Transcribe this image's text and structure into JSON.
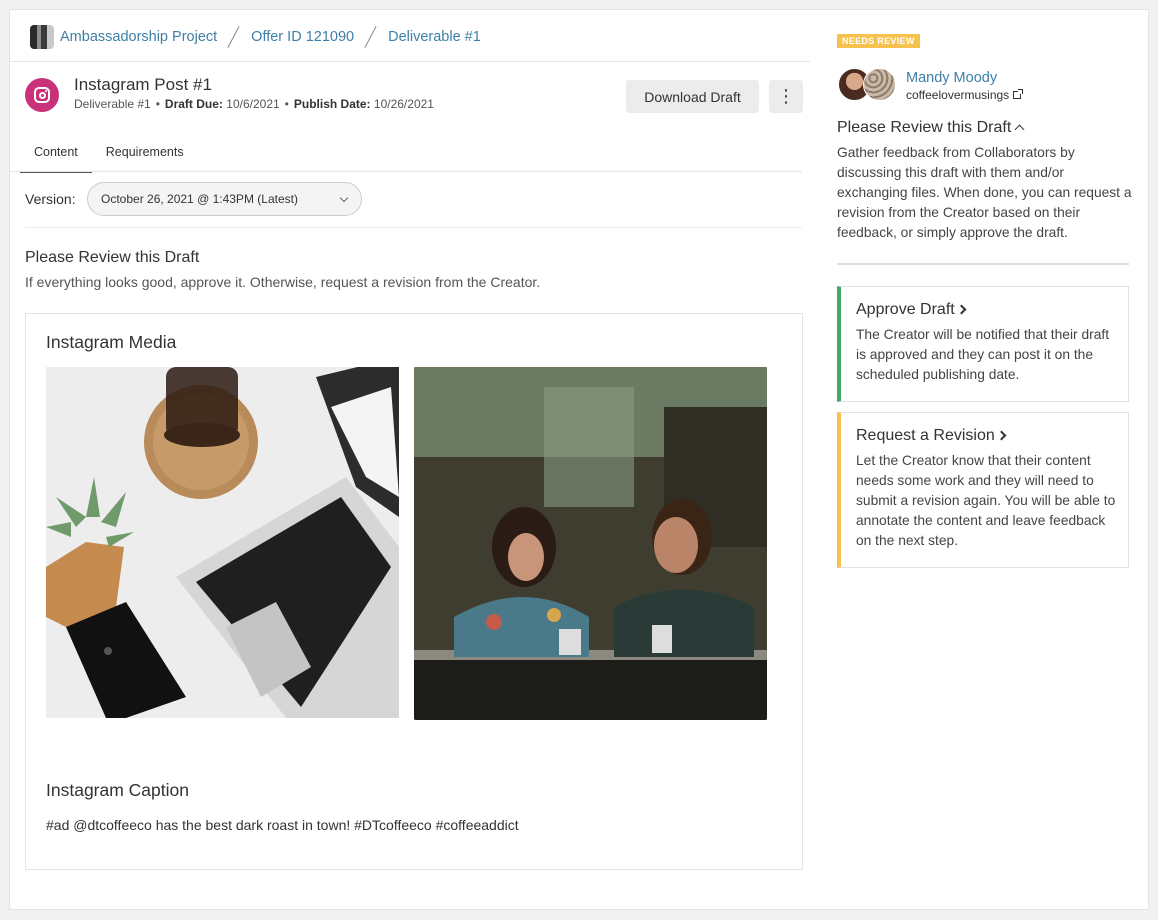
{
  "breadcrumb": {
    "project": "Ambassadorship Project",
    "offer": "Offer ID 121090",
    "deliverable": "Deliverable #1"
  },
  "header": {
    "title": "Instagram Post #1",
    "deliverable": "Deliverable #1",
    "draft_due_label": "Draft Due:",
    "draft_due": "10/6/2021",
    "publish_label": "Publish Date:",
    "publish_date": "10/26/2021",
    "separator": "•",
    "download_label": "Download Draft",
    "more_label": "⋮"
  },
  "tabs": [
    {
      "label": "Content",
      "active": true
    },
    {
      "label": "Requirements",
      "active": false
    }
  ],
  "version": {
    "label": "Version:",
    "selected": "October 26, 2021 @ 1:43PM (Latest)"
  },
  "review": {
    "title": "Please Review this Draft",
    "subtitle": "If everything looks good, approve it. Otherwise, request a revision from the Creator."
  },
  "media": {
    "heading": "Instagram Media",
    "caption_heading": "Instagram Caption",
    "caption": "#ad @dtcoffeeco has the best dark roast in town! #DTcoffeeco #coffeeaddict"
  },
  "sidebar": {
    "badge": "NEEDS REVIEW",
    "creator_name": "Mandy Moody",
    "creator_handle": "coffeelovermusings",
    "title": "Please Review this Draft",
    "description": "Gather feedback from Collaborators by discussing this draft with them and/or exchanging files. When done, you can request a revision from the Creator based on their feedback, or simply approve the draft.",
    "approve": {
      "title": "Approve Draft",
      "description": "The Creator will be notified that their draft is approved and they can post it on the scheduled publishing date."
    },
    "revision": {
      "title": "Request a Revision",
      "description": "Let the Creator know that their content needs some work and they will need to submit a revision again. You will be able to annotate the content and leave feedback on the next step."
    }
  },
  "colors": {
    "link": "#3d7fa6",
    "instagram": "#c9317a",
    "approve_accent": "#3faa6a",
    "revision_accent": "#f6c24d"
  }
}
